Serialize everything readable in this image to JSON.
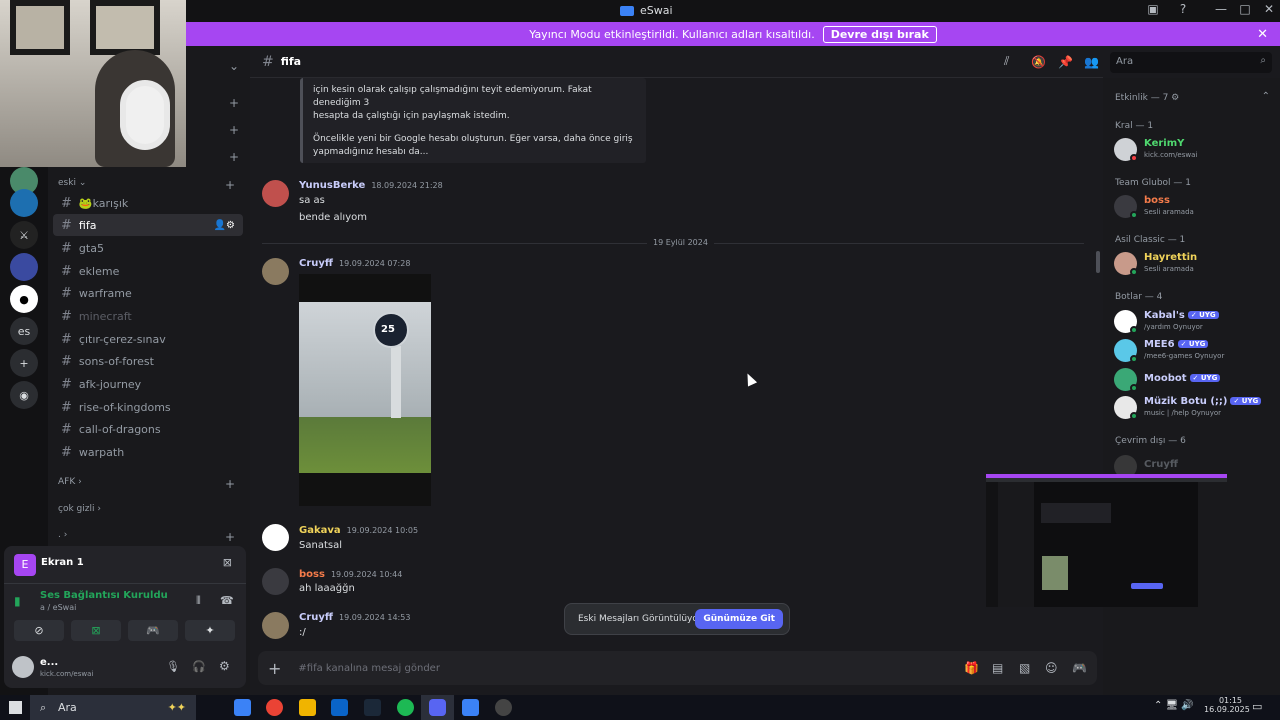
{
  "window": {
    "title": "eSwai"
  },
  "banner": {
    "text": "Yayıncı Modu etkinleştirildi. Kullanıcı adları kısaltıldı.",
    "button": "Devre dışı bırak"
  },
  "servers": {
    "es_label": "es"
  },
  "channels": {
    "cat_eski": "eski",
    "items": [
      "karışık",
      "fifa",
      "gta5",
      "ekleme",
      "warframe",
      "minecraft",
      "çıtır-çerez-sınav",
      "sons-of-forest",
      "afk-journey",
      "rise-of-kingdoms",
      "call-of-dragons",
      "warpath"
    ],
    "cat_afk": "AFK",
    "cat_cokgizli": "çok gizli"
  },
  "voice": {
    "screen_title": "Ekran 1",
    "status": "Ses Bağlantısı Kuruldu",
    "location": "a / eSwai",
    "user_name": "e...",
    "user_status": "kick.com/eswai"
  },
  "header": {
    "channel": "fifa",
    "search_placeholder": "Ara"
  },
  "chat": {
    "quote_line1": "için kesin olarak çalışıp çalışmadığını teyit edemiyorum. Fakat denediğim 3",
    "quote_line2": "hesapta da çalıştığı için paylaşmak istedim.",
    "quote_line3": "Öncelikle yeni bir Google hesabı oluşturun. Eğer varsa, daha önce giriş",
    "quote_line4": "yapmadığınız hesabı da...",
    "date_divider": "19 Eylül 2024",
    "messages": [
      {
        "name": "YunusBerke",
        "time": "18.09.2024 21:28",
        "text1": "sa as",
        "text2": "bende alıyom",
        "color": "#c9cdfb"
      },
      {
        "name": "Cruyff",
        "time": "19.09.2024 07:28",
        "color": "#c9cdfb"
      },
      {
        "name": "Gakava",
        "time": "19.09.2024 10:05",
        "text1": "Sanatsal",
        "color": "#f0d35a"
      },
      {
        "name": "boss",
        "time": "19.09.2024 10:44",
        "text1": "ah laaağğn",
        "color": "#f47b4a"
      },
      {
        "name": "Cruyff",
        "time": "19.09.2024 14:53",
        "text1": ":/",
        "color": "#c9cdfb"
      }
    ],
    "photo_badge": "25"
  },
  "toast": {
    "text": "Eski Mesajları Görüntülüyorsun",
    "button": "Günümüze Git"
  },
  "composer": {
    "placeholder": "#fifa kanalına mesaj gönder"
  },
  "members": {
    "activity": "Etkinlik — 7",
    "groups": [
      {
        "title": "Kral — 1",
        "members": [
          {
            "name": "KerimY",
            "status": "kick.com/eswai",
            "color": "#4fd86f"
          }
        ]
      },
      {
        "title": "Team Glubol — 1",
        "members": [
          {
            "name": "boss",
            "status": "Sesli aramada",
            "color": "#f47b4a"
          }
        ]
      },
      {
        "title": "Asil Classic — 1",
        "members": [
          {
            "name": "Hayrettin",
            "status": "Sesli aramada",
            "color": "#f0d35a"
          }
        ]
      },
      {
        "title": "Botlar — 4",
        "members": [
          {
            "name": "Kabal's",
            "status": "/yardım Oynuyor",
            "color": "#c9cdfb"
          },
          {
            "name": "MEE6",
            "status": "/mee6-games  Oynuyor",
            "color": "#c9cdfb"
          },
          {
            "name": "Moobot",
            "status": "",
            "color": "#c9cdfb"
          },
          {
            "name": "Müzik Botu (;;)",
            "status": "music | /help Oynuyor",
            "color": "#c9cdfb"
          }
        ]
      },
      {
        "title": "Çevrim dışı — 6",
        "members": [
          {
            "name": "Cruyff",
            "status": "",
            "color": "#6d6f78"
          }
        ]
      }
    ],
    "bot_tag": "UYG"
  },
  "taskbar": {
    "search": "Ara",
    "time": "01:15",
    "date": "16.09.2025"
  }
}
